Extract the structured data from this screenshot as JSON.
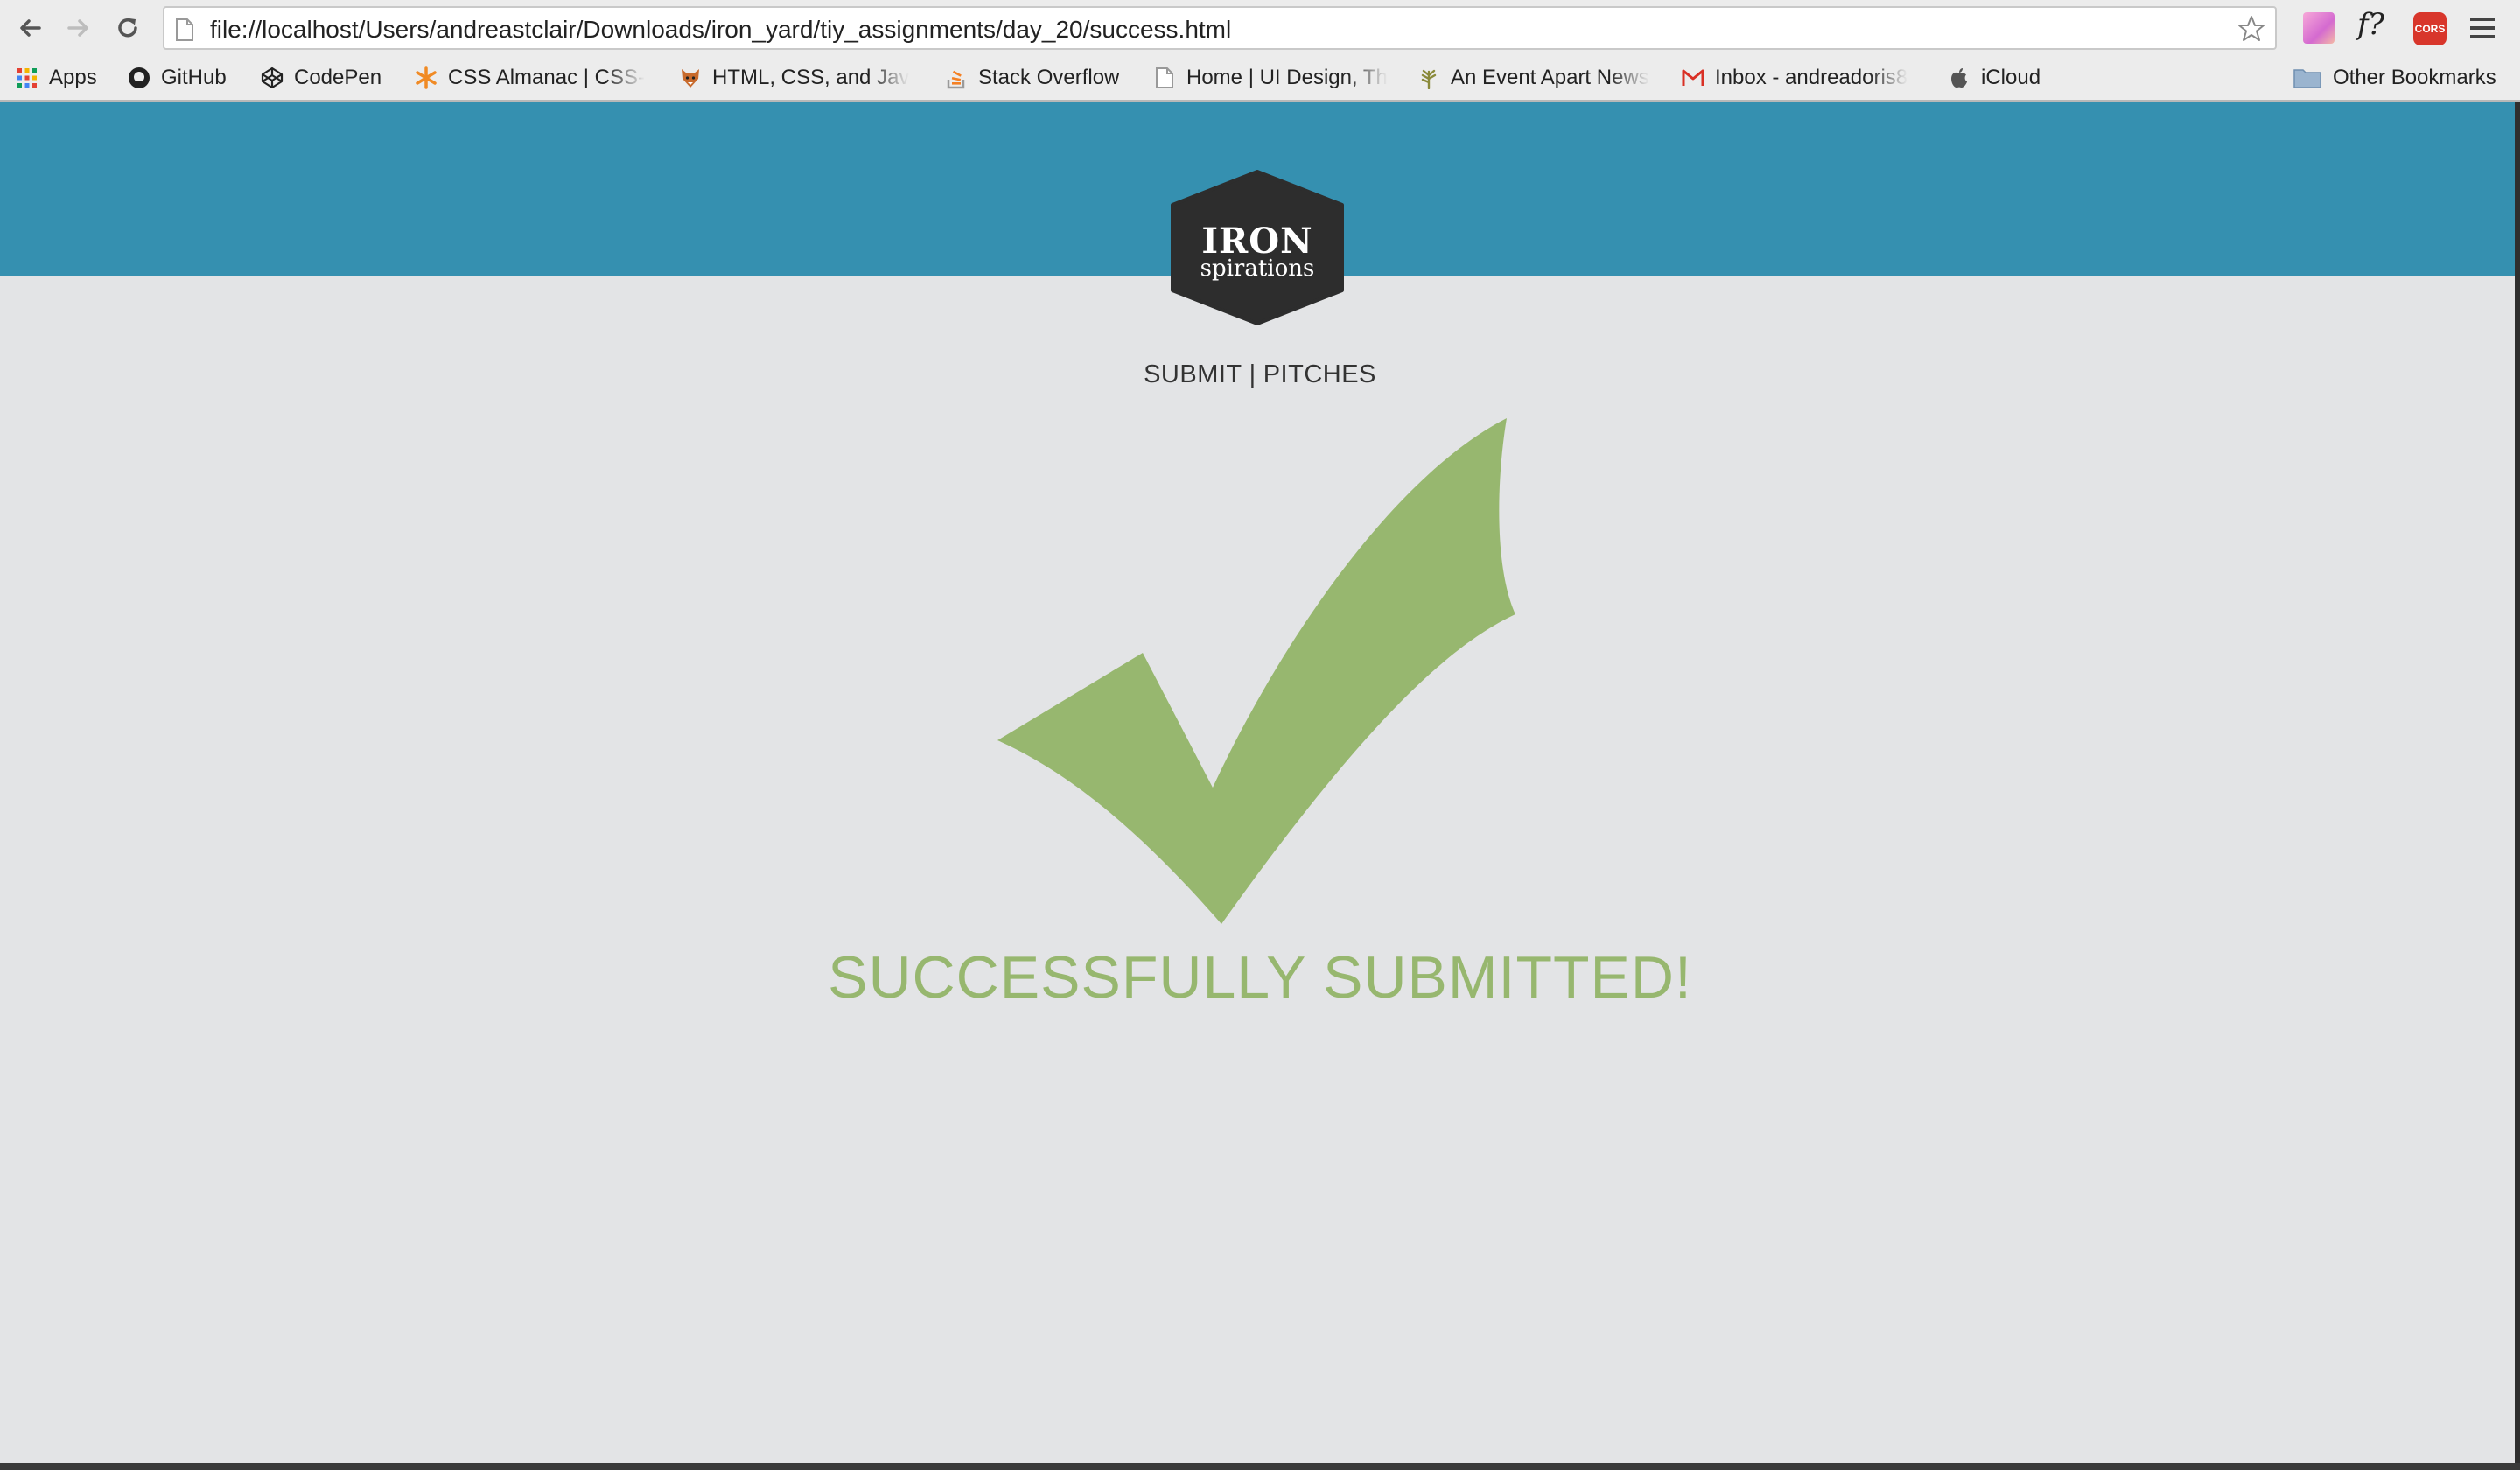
{
  "browser": {
    "url": "file://localhost/Users/andreastclair/Downloads/iron_yard/tiy_assignments/day_20/success.html",
    "bookmarks": [
      {
        "label": "Apps",
        "icon": "apps-grid-icon"
      },
      {
        "label": "GitHub",
        "icon": "github-icon"
      },
      {
        "label": "CodePen",
        "icon": "codepen-icon"
      },
      {
        "label": "CSS Almanac | CSS-",
        "icon": "css-tricks-icon"
      },
      {
        "label": "HTML, CSS, and Jav",
        "icon": "fox-icon"
      },
      {
        "label": "Stack Overflow",
        "icon": "stackoverflow-icon"
      },
      {
        "label": "Home | UI Design, Th",
        "icon": "page-icon"
      },
      {
        "label": "An Event Apart News",
        "icon": "wheat-icon"
      },
      {
        "label": "Inbox - andreadoris8",
        "icon": "gmail-icon"
      },
      {
        "label": "iCloud",
        "icon": "apple-icon"
      }
    ],
    "other_bookmarks": "Other Bookmarks",
    "extensions": [
      "gradient-extension-icon",
      "font-extension-icon",
      "cors-extension-icon"
    ],
    "font_ext_label": "f?",
    "cors_label": "CORS"
  },
  "logo": {
    "line1": "IRON",
    "line2": "spirations"
  },
  "nav": {
    "submit": "SUBMIT",
    "separator": "|",
    "pitches": "PITCHES"
  },
  "message": "SUCCESSFULLY SUBMITTED!",
  "colors": {
    "header": "#3590b0",
    "background": "#e3e4e6",
    "success_green": "#97b76f",
    "logo_hex": "#2d2d2d"
  }
}
